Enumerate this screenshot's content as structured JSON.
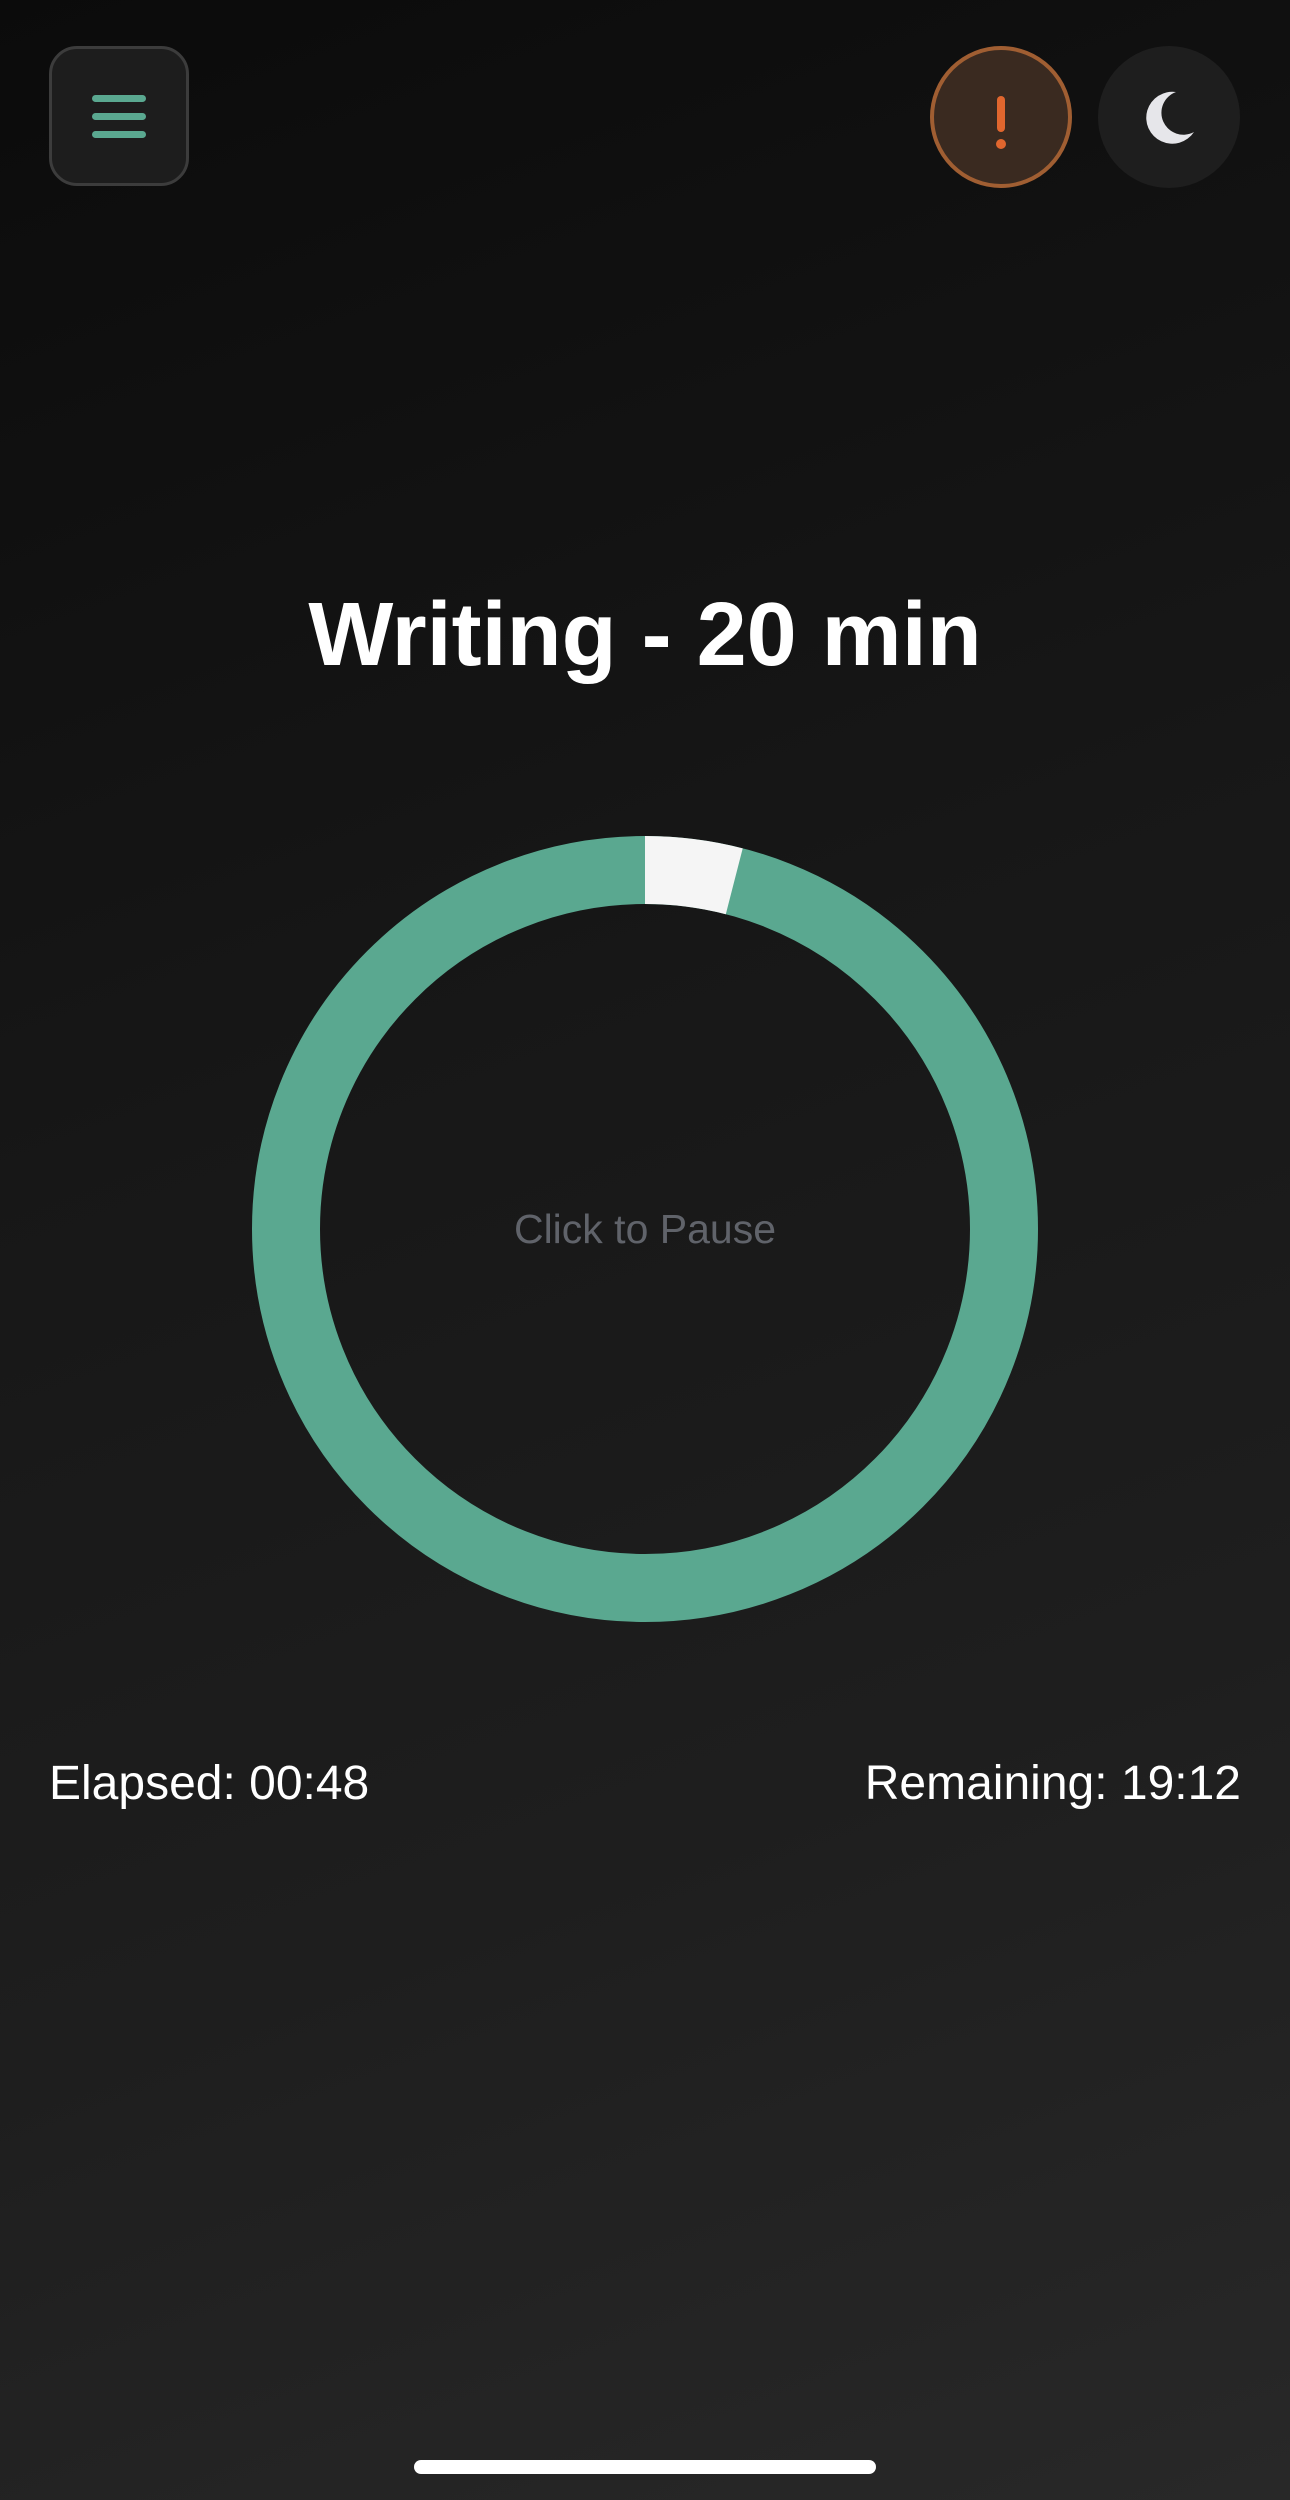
{
  "header": {
    "menu_icon": "hamburger-menu-icon",
    "alert_icon": "exclamation-icon",
    "alert_symbol": "!",
    "theme_icon": "crescent-moon-icon"
  },
  "session": {
    "title": "Writing - 20 min"
  },
  "timer": {
    "center_label": "Click to Pause",
    "progress_fraction": 0.04,
    "elapsed_text": "Elapsed: 00:48",
    "remaining_text": "Remaining: 19:12"
  },
  "colors": {
    "accent": "#5aa890",
    "ring_remaining": "#5aa890",
    "ring_elapsed": "#f5f5f5",
    "alert": "#e0662e",
    "alert_border": "#a05e32",
    "background_top": "#0b0b0b",
    "background_bottom": "#282828"
  }
}
